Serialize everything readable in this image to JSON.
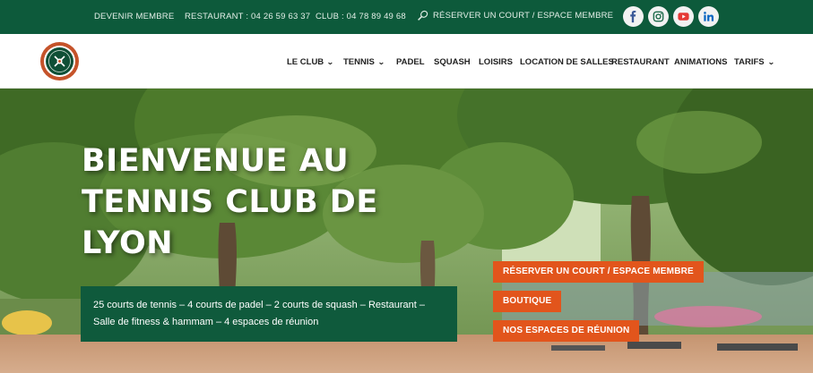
{
  "topbar": {
    "become_member": "DEVENIR MEMBRE",
    "restaurant_phone": "RESTAURANT : 04 26 59 63 37",
    "club_phone": "CLUB : 04 78 89 49 68",
    "reserve_link": "RÉSERVER UN COURT / ESPACE MEMBRE",
    "social": [
      {
        "name": "facebook-icon",
        "color": "#3b5998"
      },
      {
        "name": "instagram-icon",
        "color": "#1f6b4c"
      },
      {
        "name": "youtube-icon",
        "color": "#e53935"
      },
      {
        "name": "linkedin-icon",
        "color": "#0a66c2"
      }
    ]
  },
  "nav": {
    "items": [
      {
        "label": "LE CLUB",
        "dropdown": true
      },
      {
        "label": "TENNIS",
        "dropdown": true
      },
      {
        "label": "PADEL",
        "dropdown": false
      },
      {
        "label": "SQUASH",
        "dropdown": false
      },
      {
        "label": "LOISIRS",
        "dropdown": false
      },
      {
        "label": "LOCATION DE SALLES",
        "dropdown": false
      },
      {
        "label": "RESTAURANT",
        "dropdown": false
      },
      {
        "label": "ANIMATIONS",
        "dropdown": false
      },
      {
        "label": "TARIFS",
        "dropdown": true
      }
    ]
  },
  "hero": {
    "title_lines": [
      "BIENVENUE AU",
      "TENNIS CLUB DE",
      "LYON"
    ],
    "info_lines": [
      "25 courts de tennis – 4 courts de padel – 2 courts de squash – Restaurant –",
      "Salle de fitness & hammam – 4 espaces de réunion"
    ],
    "buttons": [
      "RÉSERVER UN COURT / ESPACE MEMBRE",
      "BOUTIQUE",
      "NOS ESPACES DE RÉUNION"
    ]
  },
  "colors": {
    "brand_green": "#0d5a3b",
    "accent_orange": "#e2551c"
  }
}
